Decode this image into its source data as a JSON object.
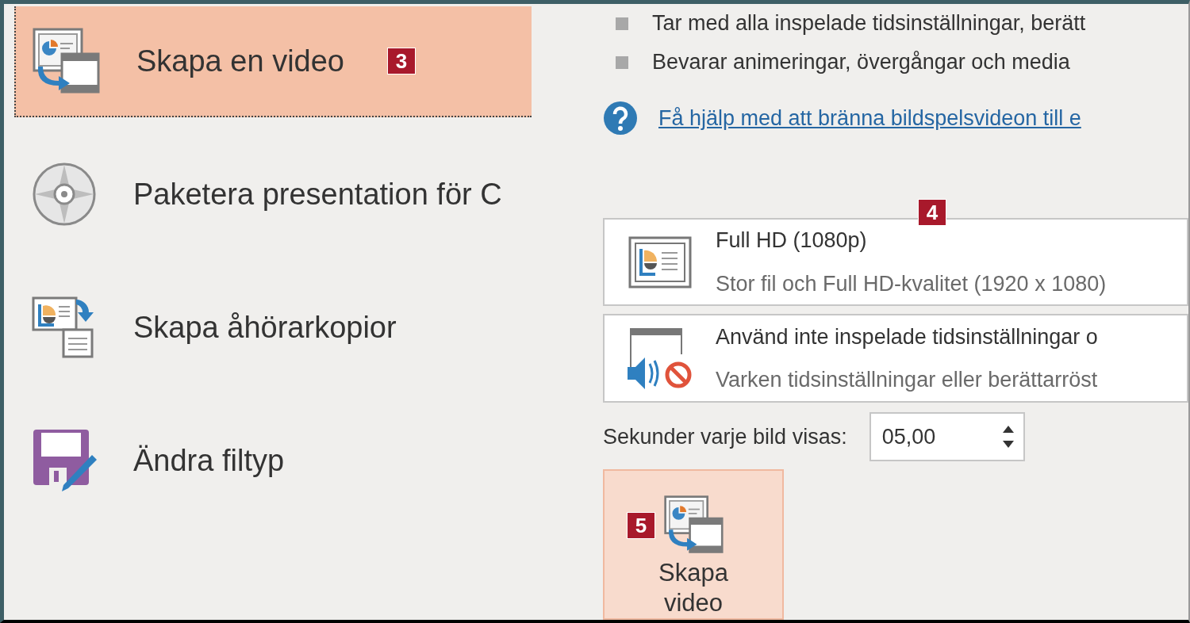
{
  "menu_items": [
    {
      "label": "Skapa en video",
      "badge": "3",
      "selected": true,
      "kind": "video"
    },
    {
      "label": "Paketera presentation för C",
      "selected": false,
      "kind": "disc"
    },
    {
      "label": "Skapa åhörarkopior",
      "selected": false,
      "kind": "handouts"
    },
    {
      "label": "Ändra filtyp",
      "selected": false,
      "kind": "filetype"
    }
  ],
  "bullets": [
    "Tar med alla inspelade tidsinställningar, berätt",
    "Bevarar animeringar, övergångar och media"
  ],
  "help_link": "Få hjälp med att bränna bildspelsvideon till e",
  "options_badge": "4",
  "options": [
    {
      "kind": "quality",
      "title": "Full HD (1080p)",
      "subtitle": "Stor fil och Full HD-kvalitet (1920 x 1080)"
    },
    {
      "kind": "timings",
      "title": "Använd inte inspelade tidsinställningar o",
      "subtitle": "Varken tidsinställningar eller berättarröst"
    }
  ],
  "seconds": {
    "label": "Sekunder varje bild visas:",
    "value": "05,00"
  },
  "create_button": {
    "label": "Skapa video",
    "badge": "5"
  }
}
